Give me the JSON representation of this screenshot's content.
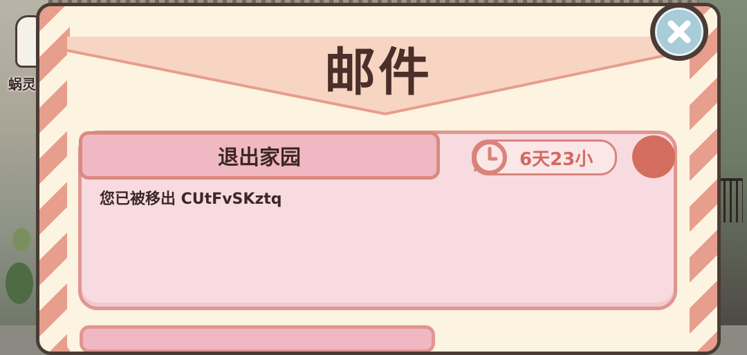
{
  "background": {
    "npc_label": "蜗灵"
  },
  "mail": {
    "title": "邮件",
    "items": [
      {
        "subject": "退出家园",
        "time_left": "6天23小",
        "body": "您已被移出 CUtFvSKztq",
        "unread": true
      }
    ]
  },
  "colors": {
    "envelope": "#fdf3e1",
    "stripe": "#e79e8d",
    "card": "#f8dbe0",
    "card_border": "#e0968f",
    "header": "#f0b8c3",
    "timer": "#d26a5f",
    "unread_dot": "#d36e5e",
    "outline": "#4a3b35",
    "close_button": "#a8ccd8"
  },
  "icons": {
    "close": "close-x-icon",
    "timer": "clock-icon"
  }
}
